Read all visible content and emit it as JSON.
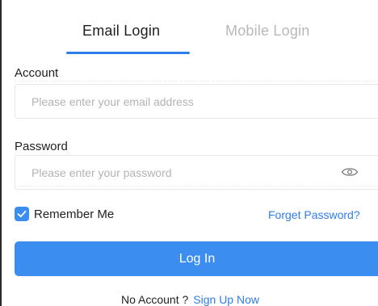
{
  "tabs": {
    "email_login": "Email Login",
    "mobile_login": "Mobile Login",
    "active": "email_login"
  },
  "account": {
    "label": "Account",
    "placeholder": "Please enter your email address",
    "value": ""
  },
  "password": {
    "label": "Password",
    "placeholder": "Please enter your password",
    "value": "",
    "visibility_icon": "eye-icon"
  },
  "remember": {
    "label": "Remember Me",
    "checked": true
  },
  "forget_password": "Forget Password?",
  "login_button": "Log In",
  "footer": {
    "no_account": "No Account ?",
    "sign_up": "Sign Up Now"
  },
  "colors": {
    "accent": "#3b8ef0",
    "link": "#2f7de8",
    "inactive_tab": "#b8b8b8"
  }
}
